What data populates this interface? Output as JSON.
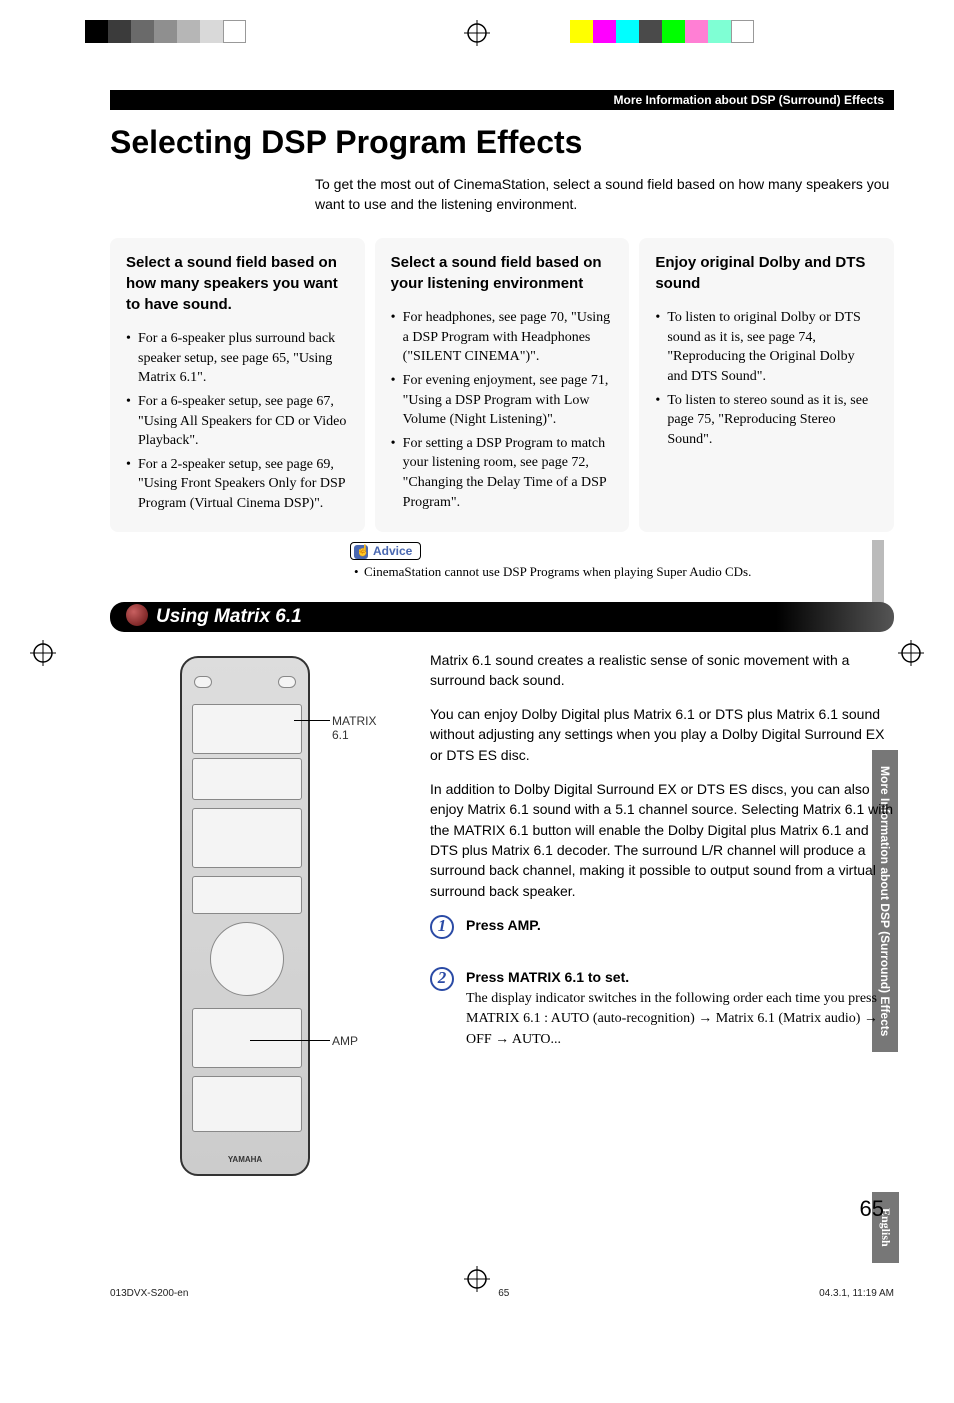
{
  "print": {
    "left_swatches": [
      "#000000",
      "#3b3b3b",
      "#6a6a6a",
      "#8f8f8f",
      "#b6b6b6",
      "#d9d9d9",
      "#ffffff"
    ],
    "right_swatches": [
      "#ffff00",
      "#ff00ff",
      "#00ffff",
      "#4a4a4a",
      "#00ff00",
      "#ff7fd4",
      "#7fffd4",
      "#ffffff"
    ]
  },
  "header_bar": "More Information about DSP (Surround) Effects",
  "title": "Selecting DSP Program Effects",
  "intro": "To get the most out of CinemaStation, select a sound field based on how many speakers you want to use and the listening environment.",
  "columns": [
    {
      "heading": "Select a sound field based on how many speakers you want to have sound.",
      "items": [
        "For a 6-speaker plus surround back speaker setup, see page 65, \"Using Matrix 6.1\".",
        "For a 6-speaker setup, see page 67, \"Using All Speakers for CD or Video Playback\".",
        "For a 2-speaker setup, see page 69, \"Using Front Speakers Only for DSP Program (Virtual Cinema DSP)\"."
      ]
    },
    {
      "heading": "Select a sound field based on your listening environment",
      "items": [
        "For headphones, see page 70, \"Using a DSP Program with Headphones (\"SILENT CINEMA\")\".",
        "For evening enjoyment, see page 71, \"Using a DSP Program with Low Volume (Night Listening)\".",
        "For setting a DSP Program to match your listening room, see page 72, \"Changing the Delay Time of a DSP Program\"."
      ]
    },
    {
      "heading": "Enjoy original Dolby and DTS sound",
      "items": [
        "To listen to original Dolby or DTS sound as it is, see page 74, \"Reproducing the Original Dolby and DTS Sound\".",
        "To listen to stereo sound as it is, see page 75, \"Reproducing Stereo Sound\"."
      ]
    }
  ],
  "advice": {
    "label": "Advice",
    "note": "CinemaStation cannot use DSP Programs when playing Super Audio CDs."
  },
  "section": {
    "title": "Using Matrix 6.1",
    "callouts": {
      "matrix": "MATRIX 6.1",
      "amp": "AMP"
    },
    "paragraphs": [
      "Matrix 6.1 sound creates a realistic sense of sonic movement with a surround back sound.",
      "You can enjoy Dolby Digital plus Matrix 6.1 or DTS plus Matrix 6.1 sound without adjusting any settings when you play a Dolby Digital Surround EX or DTS ES disc.",
      "In addition to Dolby Digital Surround EX or DTS ES discs, you can also enjoy Matrix 6.1 sound with a 5.1 channel source. Selecting Matrix 6.1 with the MATRIX 6.1 button will enable the Dolby Digital plus Matrix 6.1 and DTS plus Matrix 6.1 decoder. The surround L/R channel will produce a surround back channel, making it possible to output sound from a virtual surround back speaker."
    ],
    "steps": [
      {
        "num": "1",
        "title": "Press AMP.",
        "detail": ""
      },
      {
        "num": "2",
        "title": "Press MATRIX 6.1 to set.",
        "detail": "The display indicator switches in the following order each time you press MATRIX 6.1 : AUTO (auto-recognition) → Matrix 6.1 (Matrix audio) → OFF → AUTO..."
      }
    ]
  },
  "side_tabs": {
    "light_placeholder": "",
    "section": "More Information about DSP (Surround) Effects",
    "language": "English"
  },
  "page_number": "65",
  "footer": {
    "left": "013DVX-S200-en",
    "center": "65",
    "right": "04.3.1, 11:19 AM"
  }
}
